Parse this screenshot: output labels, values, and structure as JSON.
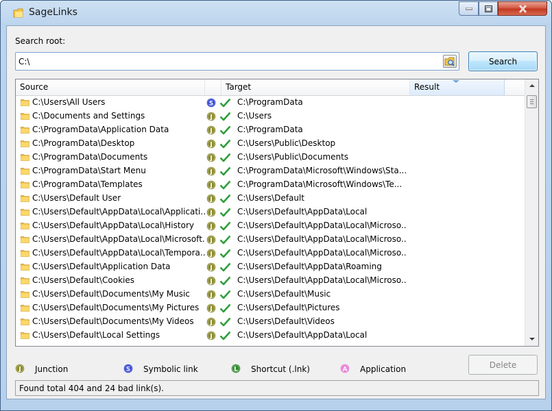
{
  "window": {
    "title": "SageLinks"
  },
  "search": {
    "root_label": "Search root:",
    "root_value": "C:\\",
    "button_label": "Search"
  },
  "list": {
    "columns": {
      "source": "Source",
      "target": "Target",
      "result": "Result"
    },
    "rows": [
      {
        "source": "C:\\Users\\All Users",
        "type": "S",
        "target": "C:\\ProgramData"
      },
      {
        "source": "C:\\Documents and Settings",
        "type": "J",
        "target": "C:\\Users"
      },
      {
        "source": "C:\\ProgramData\\Application Data",
        "type": "J",
        "target": "C:\\ProgramData"
      },
      {
        "source": "C:\\ProgramData\\Desktop",
        "type": "J",
        "target": "C:\\Users\\Public\\Desktop"
      },
      {
        "source": "C:\\ProgramData\\Documents",
        "type": "J",
        "target": "C:\\Users\\Public\\Documents"
      },
      {
        "source": "C:\\ProgramData\\Start Menu",
        "type": "J",
        "target": "C:\\ProgramData\\Microsoft\\Windows\\Sta..."
      },
      {
        "source": "C:\\ProgramData\\Templates",
        "type": "J",
        "target": "C:\\ProgramData\\Microsoft\\Windows\\Te..."
      },
      {
        "source": "C:\\Users\\Default User",
        "type": "J",
        "target": "C:\\Users\\Default"
      },
      {
        "source": "C:\\Users\\Default\\AppData\\Local\\Applicati...",
        "type": "J",
        "target": "C:\\Users\\Default\\AppData\\Local"
      },
      {
        "source": "C:\\Users\\Default\\AppData\\Local\\History",
        "type": "J",
        "target": "C:\\Users\\Default\\AppData\\Local\\Microso..."
      },
      {
        "source": "C:\\Users\\Default\\AppData\\Local\\Microsoft...",
        "type": "J",
        "target": "C:\\Users\\Default\\AppData\\Local\\Microso..."
      },
      {
        "source": "C:\\Users\\Default\\AppData\\Local\\Tempora...",
        "type": "J",
        "target": "C:\\Users\\Default\\AppData\\Local\\Microso..."
      },
      {
        "source": "C:\\Users\\Default\\Application Data",
        "type": "J",
        "target": "C:\\Users\\Default\\AppData\\Roaming"
      },
      {
        "source": "C:\\Users\\Default\\Cookies",
        "type": "J",
        "target": "C:\\Users\\Default\\AppData\\Local\\Microso..."
      },
      {
        "source": "C:\\Users\\Default\\Documents\\My Music",
        "type": "J",
        "target": "C:\\Users\\Default\\Music"
      },
      {
        "source": "C:\\Users\\Default\\Documents\\My Pictures",
        "type": "J",
        "target": "C:\\Users\\Default\\Pictures"
      },
      {
        "source": "C:\\Users\\Default\\Documents\\My Videos",
        "type": "J",
        "target": "C:\\Users\\Default\\Videos"
      },
      {
        "source": "C:\\Users\\Default\\Local Settings",
        "type": "J",
        "target": "C:\\Users\\Default\\AppData\\Local"
      }
    ]
  },
  "legend": {
    "junction": {
      "letter": "J",
      "label": "Junction",
      "color": "#8b8b2e"
    },
    "symbolic": {
      "letter": "S",
      "label": "Symbolic link",
      "color": "#2b3fcf"
    },
    "shortcut": {
      "letter": "L",
      "label": "Shortcut (.lnk)",
      "color": "#2e8b2e"
    },
    "application": {
      "letter": "A",
      "label": "Application",
      "color": "#e676d6"
    }
  },
  "delete_label": "Delete",
  "status_text": "Found total 404 and 24 bad link(s).",
  "icons": {
    "app": "folder-link-icon",
    "row_folder": "folder-icon",
    "ok": "green-check-icon",
    "browse": "browse-folder-icon"
  }
}
